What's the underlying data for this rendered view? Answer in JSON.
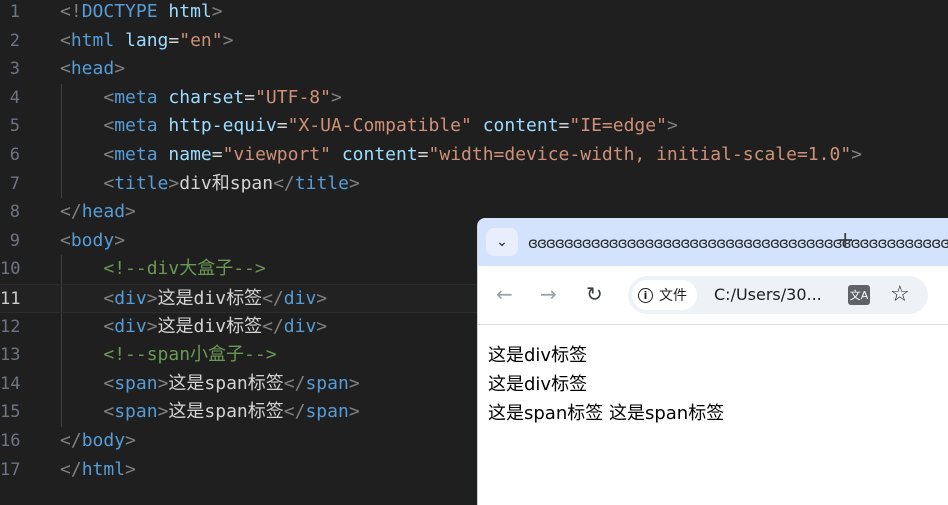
{
  "editor": {
    "line_numbers": [
      "1",
      "2",
      "3",
      "4",
      "5",
      "6",
      "7",
      "8",
      "9",
      "10",
      "11",
      "12",
      "13",
      "14",
      "15",
      "16",
      "17"
    ],
    "current_line": "11",
    "lines": [
      [
        [
          "p",
          "<!"
        ],
        [
          "t",
          "DOCTYPE "
        ],
        [
          "a",
          "html"
        ],
        [
          "p",
          ">"
        ]
      ],
      [
        [
          "p",
          "<"
        ],
        [
          "t",
          "html "
        ],
        [
          "a",
          "lang"
        ],
        [
          "x",
          "="
        ],
        [
          "s",
          "\"en\""
        ],
        [
          "p",
          ">"
        ]
      ],
      [
        [
          "p",
          "<"
        ],
        [
          "t",
          "head"
        ],
        [
          "p",
          ">"
        ]
      ],
      [
        [
          "x",
          "    "
        ],
        [
          "p",
          "<"
        ],
        [
          "t",
          "meta "
        ],
        [
          "a",
          "charset"
        ],
        [
          "x",
          "="
        ],
        [
          "s",
          "\"UTF-8\""
        ],
        [
          "p",
          ">"
        ]
      ],
      [
        [
          "x",
          "    "
        ],
        [
          "p",
          "<"
        ],
        [
          "t",
          "meta "
        ],
        [
          "a",
          "http-equiv"
        ],
        [
          "x",
          "="
        ],
        [
          "s",
          "\"X-UA-Compatible\" "
        ],
        [
          "a",
          "content"
        ],
        [
          "x",
          "="
        ],
        [
          "s",
          "\"IE=edge\""
        ],
        [
          "p",
          ">"
        ]
      ],
      [
        [
          "x",
          "    "
        ],
        [
          "p",
          "<"
        ],
        [
          "t",
          "meta "
        ],
        [
          "a",
          "name"
        ],
        [
          "x",
          "="
        ],
        [
          "s",
          "\"viewport\" "
        ],
        [
          "a",
          "content"
        ],
        [
          "x",
          "="
        ],
        [
          "s",
          "\"width=device-width, initial-scale=1.0\""
        ],
        [
          "p",
          ">"
        ]
      ],
      [
        [
          "x",
          "    "
        ],
        [
          "p",
          "<"
        ],
        [
          "t",
          "title"
        ],
        [
          "p",
          ">"
        ],
        [
          "x",
          "div和span"
        ],
        [
          "p",
          "</"
        ],
        [
          "t",
          "title"
        ],
        [
          "p",
          ">"
        ]
      ],
      [
        [
          "p",
          "</"
        ],
        [
          "t",
          "head"
        ],
        [
          "p",
          ">"
        ]
      ],
      [
        [
          "p",
          "<"
        ],
        [
          "t",
          "body"
        ],
        [
          "p",
          ">"
        ]
      ],
      [
        [
          "x",
          "    "
        ],
        [
          "c",
          "<!--div大盒子-->"
        ]
      ],
      [
        [
          "x",
          "    "
        ],
        [
          "p",
          "<"
        ],
        [
          "t",
          "div"
        ],
        [
          "p",
          ">"
        ],
        [
          "x",
          "这是div标签"
        ],
        [
          "p",
          "</"
        ],
        [
          "t",
          "div"
        ],
        [
          "p",
          ">"
        ]
      ],
      [
        [
          "x",
          "    "
        ],
        [
          "p",
          "<"
        ],
        [
          "t",
          "div"
        ],
        [
          "p",
          ">"
        ],
        [
          "x",
          "这是div标签"
        ],
        [
          "p",
          "</"
        ],
        [
          "t",
          "div"
        ],
        [
          "p",
          ">"
        ]
      ],
      [
        [
          "x",
          "    "
        ],
        [
          "c",
          "<!--span小盒子-->"
        ]
      ],
      [
        [
          "x",
          "    "
        ],
        [
          "p",
          "<"
        ],
        [
          "t",
          "span"
        ],
        [
          "p",
          ">"
        ],
        [
          "x",
          "这是span标签"
        ],
        [
          "p",
          "</"
        ],
        [
          "t",
          "span"
        ],
        [
          "p",
          ">"
        ]
      ],
      [
        [
          "x",
          "    "
        ],
        [
          "p",
          "<"
        ],
        [
          "t",
          "span"
        ],
        [
          "p",
          ">"
        ],
        [
          "x",
          "这是span标签"
        ],
        [
          "p",
          "</"
        ],
        [
          "t",
          "span"
        ],
        [
          "p",
          ">"
        ]
      ],
      [
        [
          "p",
          "</"
        ],
        [
          "t",
          "body"
        ],
        [
          "p",
          ">"
        ]
      ],
      [
        [
          "p",
          "</"
        ],
        [
          "t",
          "html"
        ],
        [
          "p",
          ">"
        ]
      ]
    ]
  },
  "browser": {
    "tab_title": "ɞɞɞɞɞɞɞɞɞɞɞɞɞɞɞɞɞɞɞɞɞɞɞɞɞɞɞɞɞɞɞɞɞɞɞɞɞɞɞɞɞɞɞɞɞɞɞɞ",
    "menu_icon": "chevron-down-icon",
    "new_tab_label": "+",
    "back_label": "←",
    "forward_label": "→",
    "reload_label": "↻",
    "info_label": "文件",
    "url": "C:/Users/30...",
    "translate_label": "文A",
    "star_label": "☆",
    "page_lines": [
      "这是div标签",
      "这是div标签",
      "这是span标签 这是span标签"
    ]
  },
  "colors": {
    "editor_bg": "#1f1f1f",
    "tag": "#569cd6",
    "attribute": "#9cdcfe",
    "string": "#ce9178",
    "comment": "#6a9955",
    "tabstrip": "#d3e3fd"
  }
}
